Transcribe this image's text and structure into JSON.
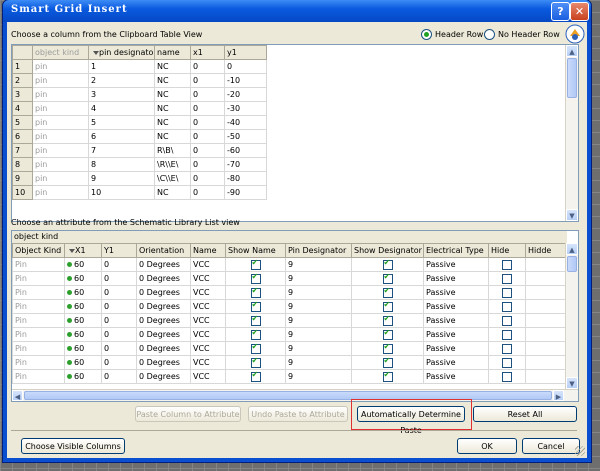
{
  "dialog": {
    "title": "Smart Grid Insert",
    "help_glyph": "?",
    "close_glyph": "✕"
  },
  "clipboard": {
    "label": "Choose a column from the Clipboard Table View",
    "header_row_label": "Header Row",
    "no_header_row_label": "No Header Row",
    "header_row_selected": true,
    "meta_row": [
      "object kind",
      "pin designator",
      "name",
      "x1",
      "y1"
    ],
    "rows": [
      [
        "1",
        "pin",
        "1",
        "NC",
        "0",
        "0"
      ],
      [
        "2",
        "pin",
        "2",
        "NC",
        "0",
        "-10"
      ],
      [
        "3",
        "pin",
        "3",
        "NC",
        "0",
        "-20"
      ],
      [
        "4",
        "pin",
        "4",
        "NC",
        "0",
        "-30"
      ],
      [
        "5",
        "pin",
        "5",
        "NC",
        "0",
        "-40"
      ],
      [
        "6",
        "pin",
        "6",
        "NC",
        "0",
        "-50"
      ],
      [
        "7",
        "pin",
        "7",
        "R\\B\\",
        "0",
        "-60"
      ],
      [
        "8",
        "pin",
        "8",
        "\\R\\\\E\\",
        "0",
        "-70"
      ],
      [
        "9",
        "pin",
        "9",
        "\\C\\\\E\\",
        "0",
        "-80"
      ],
      [
        "10",
        "pin",
        "10",
        "NC",
        "0",
        "-90"
      ]
    ]
  },
  "attribute": {
    "label": "Choose an attribute from the Schematic Library List view",
    "group_label": "object kind",
    "headers": [
      "Object Kind",
      "X1",
      "Y1",
      "Orientation",
      "Name",
      "Show Name",
      "Pin Designator",
      "Show Designator",
      "Electrical Type",
      "Hide",
      "Hidde"
    ],
    "rows": [
      {
        "kind": "Pin",
        "x1": "60",
        "y1": "0",
        "orientation": "0 Degrees",
        "name": "VCC",
        "show_name": true,
        "pin_designator": "9",
        "show_designator": true,
        "electrical_type": "Passive",
        "hide": false
      },
      {
        "kind": "Pin",
        "x1": "60",
        "y1": "0",
        "orientation": "0 Degrees",
        "name": "VCC",
        "show_name": true,
        "pin_designator": "9",
        "show_designator": true,
        "electrical_type": "Passive",
        "hide": false
      },
      {
        "kind": "Pin",
        "x1": "60",
        "y1": "0",
        "orientation": "0 Degrees",
        "name": "VCC",
        "show_name": true,
        "pin_designator": "9",
        "show_designator": true,
        "electrical_type": "Passive",
        "hide": false
      },
      {
        "kind": "Pin",
        "x1": "60",
        "y1": "0",
        "orientation": "0 Degrees",
        "name": "VCC",
        "show_name": true,
        "pin_designator": "9",
        "show_designator": true,
        "electrical_type": "Passive",
        "hide": false
      },
      {
        "kind": "Pin",
        "x1": "60",
        "y1": "0",
        "orientation": "0 Degrees",
        "name": "VCC",
        "show_name": true,
        "pin_designator": "9",
        "show_designator": true,
        "electrical_type": "Passive",
        "hide": false
      },
      {
        "kind": "Pin",
        "x1": "60",
        "y1": "0",
        "orientation": "0 Degrees",
        "name": "VCC",
        "show_name": true,
        "pin_designator": "9",
        "show_designator": true,
        "electrical_type": "Passive",
        "hide": false
      },
      {
        "kind": "Pin",
        "x1": "60",
        "y1": "0",
        "orientation": "0 Degrees",
        "name": "VCC",
        "show_name": true,
        "pin_designator": "9",
        "show_designator": true,
        "electrical_type": "Passive",
        "hide": false
      },
      {
        "kind": "Pin",
        "x1": "60",
        "y1": "0",
        "orientation": "0 Degrees",
        "name": "VCC",
        "show_name": true,
        "pin_designator": "9",
        "show_designator": true,
        "electrical_type": "Passive",
        "hide": false
      },
      {
        "kind": "Pin",
        "x1": "60",
        "y1": "0",
        "orientation": "0 Degrees",
        "name": "VCC",
        "show_name": true,
        "pin_designator": "9",
        "show_designator": true,
        "electrical_type": "Passive",
        "hide": false
      }
    ]
  },
  "buttons": {
    "paste_column": "Paste Column to Attribute",
    "undo_paste": "Undo Paste to Attribute",
    "auto_determine": "Automatically Determine Paste",
    "reset_all": "Reset All",
    "choose_columns": "Choose Visible Columns",
    "ok": "OK",
    "cancel": "Cancel"
  },
  "colors": {
    "titlebar": "#0a5ae0",
    "highlight_box": "#e03030",
    "pin_dot": "#2ea02e"
  }
}
